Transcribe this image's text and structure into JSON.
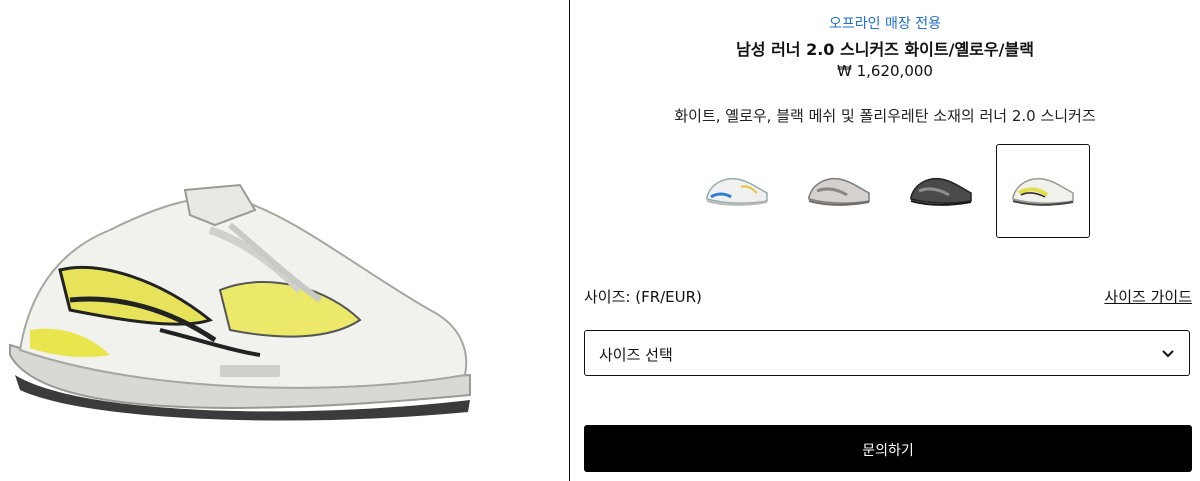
{
  "product": {
    "availability": "오프라인 매장 전용",
    "name": "남성 러너 2.0 스니커즈 화이트/옐로우/블랙",
    "price": "₩ 1,620,000",
    "description": "화이트, 옐로우, 블랙 메쉬 및 폴리우레탄 소재의 러너 2.0 스니커즈"
  },
  "colors": {
    "accent_link": "#1f6fd6",
    "button_bg": "#000000",
    "button_text": "#ffffff",
    "border": "#111111"
  },
  "swatches": [
    {
      "name": "white-blue",
      "selected": false
    },
    {
      "name": "grey",
      "selected": false
    },
    {
      "name": "black",
      "selected": false
    },
    {
      "name": "white-yellow-black",
      "selected": true
    }
  ],
  "size": {
    "label": "사이즈: (FR/EUR)",
    "guide_link": "사이즈 가이드",
    "select_placeholder": "사이즈 선택"
  },
  "cta": {
    "label": "문의하기"
  }
}
